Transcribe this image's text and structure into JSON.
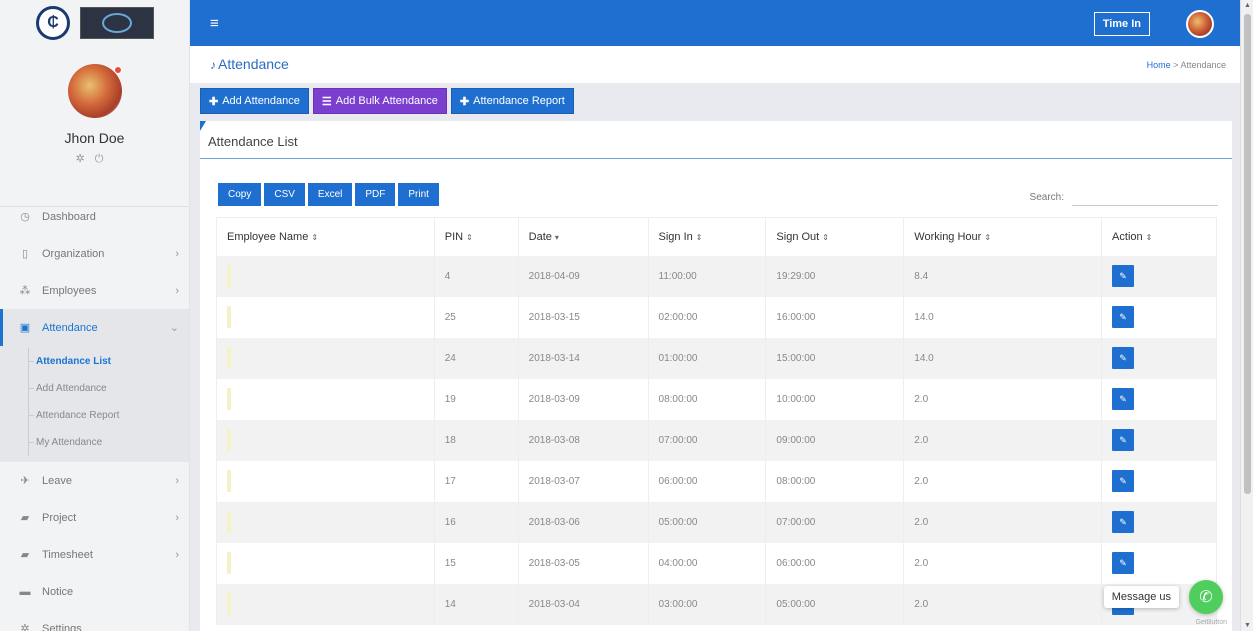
{
  "colors": {
    "primary": "#1f6fd1",
    "purple": "#7b3fd0",
    "whatsapp": "#4fce5d"
  },
  "profile": {
    "name": "Jhon Doe"
  },
  "sidebar": {
    "items": [
      {
        "label": "Dashboard",
        "icon": "dashboard-icon",
        "glyph": "◷"
      },
      {
        "label": "Organization",
        "icon": "building-icon",
        "glyph": "▯"
      },
      {
        "label": "Employees",
        "icon": "users-icon",
        "glyph": "⁂"
      },
      {
        "label": "Attendance",
        "icon": "attendance-icon",
        "glyph": "▣"
      },
      {
        "label": "Leave",
        "icon": "leave-icon",
        "glyph": "✈"
      },
      {
        "label": "Project",
        "icon": "briefcase-icon",
        "glyph": "▰"
      },
      {
        "label": "Timesheet",
        "icon": "briefcase-icon",
        "glyph": "▰"
      },
      {
        "label": "Notice",
        "icon": "notice-icon",
        "glyph": "▬"
      },
      {
        "label": "Settings",
        "icon": "gear-icon",
        "glyph": "✲"
      }
    ],
    "attendance_sub": [
      "Attendance List",
      "Add Attendance",
      "Attendance Report",
      "My Attendance"
    ]
  },
  "topbar": {
    "time_in": "Time In"
  },
  "header": {
    "title": "Attendance",
    "breadcrumb_home": "Home",
    "breadcrumb_sep": ">",
    "breadcrumb_current": "Attendance"
  },
  "actions": {
    "add": "Add Attendance",
    "bulk": "Add Bulk Attendance",
    "report": "Attendance Report"
  },
  "card": {
    "title": "Attendance List"
  },
  "export": [
    "Copy",
    "CSV",
    "Excel",
    "PDF",
    "Print"
  ],
  "search": {
    "label": "Search:"
  },
  "table": {
    "headers": [
      "Employee Name",
      "PIN",
      "Date",
      "Sign In",
      "Sign Out",
      "Working Hour",
      "Action"
    ],
    "rows": [
      [
        "",
        "4",
        "2018-04-09",
        "11:00:00",
        "19:29:00",
        "8.4"
      ],
      [
        "",
        "25",
        "2018-03-15",
        "02:00:00",
        "16:00:00",
        "14.0"
      ],
      [
        "",
        "24",
        "2018-03-14",
        "01:00:00",
        "15:00:00",
        "14.0"
      ],
      [
        "",
        "19",
        "2018-03-09",
        "08:00:00",
        "10:00:00",
        "2.0"
      ],
      [
        "",
        "18",
        "2018-03-08",
        "07:00:00",
        "09:00:00",
        "2.0"
      ],
      [
        "",
        "17",
        "2018-03-07",
        "06:00:00",
        "08:00:00",
        "2.0"
      ],
      [
        "",
        "16",
        "2018-03-06",
        "05:00:00",
        "07:00:00",
        "2.0"
      ],
      [
        "",
        "15",
        "2018-03-05",
        "04:00:00",
        "06:00:00",
        "2.0"
      ],
      [
        "",
        "14",
        "2018-03-04",
        "03:00:00",
        "05:00:00",
        "2.0"
      ]
    ]
  },
  "chat": {
    "label": "Message us",
    "brand": "GetButton"
  }
}
